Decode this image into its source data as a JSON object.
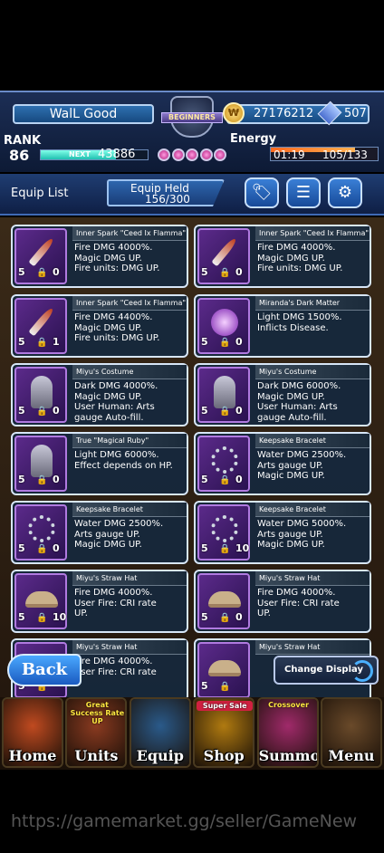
{
  "header": {
    "player_name": "WalL Good",
    "rank_label": "RANK",
    "rank": "86",
    "next_label": "NEXT",
    "next_exp": "43886",
    "exp_progress": 0.7,
    "badge_text": "BEGINNERS",
    "coins": "27176212",
    "crystals": "507",
    "energy_label": "Energy",
    "energy_timer": "01:19",
    "energy": "105/133",
    "energy_progress": 0.79
  },
  "list_bar": {
    "title": "Equip List",
    "held_label": "Equip Held",
    "held_value": "156/300",
    "tools": [
      "tag-icon",
      "sort-icon",
      "gear-icon"
    ]
  },
  "cards": [
    {
      "name": "Inner Spark \"Ceed Ix Flamma\"",
      "desc": "Fire DMG 4000%.\nMagic DMG UP.\nFire units: DMG UP.",
      "stars": "5",
      "count": "0",
      "art": "blade"
    },
    {
      "name": "Inner Spark \"Ceed Ix Flamma\"",
      "desc": "Fire DMG 4000%.\nMagic DMG UP.\nFire units: DMG UP.",
      "stars": "5",
      "count": "0",
      "art": "blade"
    },
    {
      "name": "Inner Spark \"Ceed Ix Flamma\"",
      "desc": "Fire DMG 4400%.\nMagic DMG UP.\nFire units: DMG UP.",
      "stars": "5",
      "count": "1",
      "art": "blade"
    },
    {
      "name": "Miranda's Dark Matter",
      "desc": "Light DMG 1500%.\nInflicts Disease.",
      "stars": "5",
      "count": "0",
      "art": "orb"
    },
    {
      "name": "Miyu's Costume",
      "desc": "Dark DMG 4000%.\nMagic DMG UP.\nUser Human: Arts\ngauge Auto-fill.",
      "stars": "5",
      "count": "0",
      "art": "figure"
    },
    {
      "name": "Miyu's Costume",
      "desc": "Dark DMG 6000%.\nMagic DMG UP.\nUser Human: Arts\ngauge Auto-fill.",
      "stars": "5",
      "count": "0",
      "art": "figure"
    },
    {
      "name": "True \"Magical Ruby\"",
      "desc": "Light DMG 6000%.\nEffect depends on HP.",
      "stars": "5",
      "count": "0",
      "art": "figure"
    },
    {
      "name": "Keepsake Bracelet",
      "desc": "Water DMG 2500%.\nArts gauge UP.\nMagic DMG UP.",
      "stars": "5",
      "count": "0",
      "art": "ring"
    },
    {
      "name": "Keepsake Bracelet",
      "desc": "Water DMG 2500%.\nArts gauge UP.\nMagic DMG UP.",
      "stars": "5",
      "count": "0",
      "art": "ring"
    },
    {
      "name": "Keepsake Bracelet",
      "desc": "Water DMG 5000%.\nArts gauge UP.\nMagic DMG UP.",
      "stars": "5",
      "count": "10",
      "art": "ring"
    },
    {
      "name": "Miyu's Straw Hat",
      "desc": "Fire DMG 4000%.\nUser Fire: CRI rate\nUP.",
      "stars": "5",
      "count": "10",
      "art": "hat"
    },
    {
      "name": "Miyu's Straw Hat",
      "desc": "Fire DMG 4000%.\nUser Fire: CRI rate\nUP.",
      "stars": "5",
      "count": "0",
      "art": "hat"
    },
    {
      "name": "Miyu's Straw Hat",
      "desc": "Fire DMG 4000%.\nUser Fire: CRI rate",
      "stars": "5",
      "count": "",
      "art": "hat"
    },
    {
      "name": "Miyu's Straw Hat",
      "desc": "",
      "stars": "5",
      "count": "",
      "art": "hat"
    }
  ],
  "buttons": {
    "back": "Back",
    "change_display": "Change Display"
  },
  "nav": [
    {
      "label": "Home",
      "badge": "",
      "color": "#c04a20"
    },
    {
      "label": "Units",
      "badge": "Great Success Rate UP",
      "color": "#8a3a20"
    },
    {
      "label": "Equip",
      "badge": "",
      "color": "#2a5a8a"
    },
    {
      "label": "Shop",
      "badge": "Super Sale",
      "color": "#b07a10"
    },
    {
      "label": "Summon",
      "badge": "Crossover",
      "color": "#a02a6a"
    },
    {
      "label": "Menu",
      "badge": "",
      "color": "#6a4a2a"
    }
  ],
  "watermark": "https://gamemarket.gg/seller/GameNew"
}
